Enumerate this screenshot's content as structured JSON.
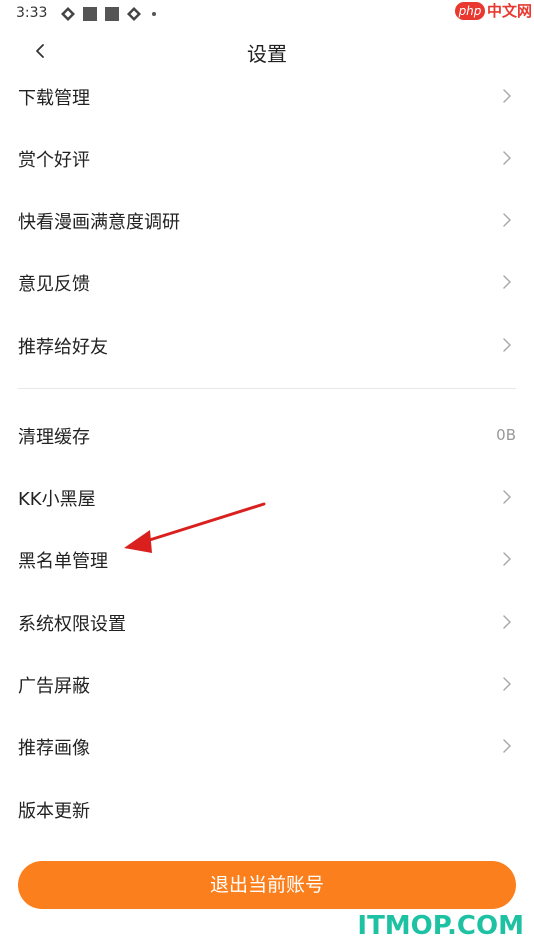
{
  "status_bar": {
    "time": "3:33"
  },
  "watermark_top": {
    "badge": "php",
    "text": "中文网"
  },
  "header": {
    "title": "设置",
    "back_icon": "chevron-left-icon"
  },
  "settings": {
    "group1": [
      {
        "label": "下载管理"
      },
      {
        "label": "赏个好评"
      },
      {
        "label": "快看漫画满意度调研"
      },
      {
        "label": "意见反馈"
      },
      {
        "label": "推荐给好友"
      }
    ],
    "group2": [
      {
        "label": "清理缓存",
        "value": "0B"
      },
      {
        "label": "KK小黑屋"
      },
      {
        "label": "黑名单管理"
      },
      {
        "label": "系统权限设置"
      },
      {
        "label": "广告屏蔽"
      },
      {
        "label": "推荐画像"
      },
      {
        "label": "版本更新"
      }
    ]
  },
  "logout_button": {
    "label": "退出当前账号"
  },
  "watermark_bottom": {
    "text": "ITMOP.COM"
  },
  "colors": {
    "accent": "#fc7f1d",
    "annotation_arrow": "#d9201e",
    "watermark_green": "#1ec2a2",
    "watermark_red": "#e8382f"
  },
  "icons": {
    "row_chevron": "chevron-right-icon",
    "annotation": "red-arrow-icon"
  }
}
